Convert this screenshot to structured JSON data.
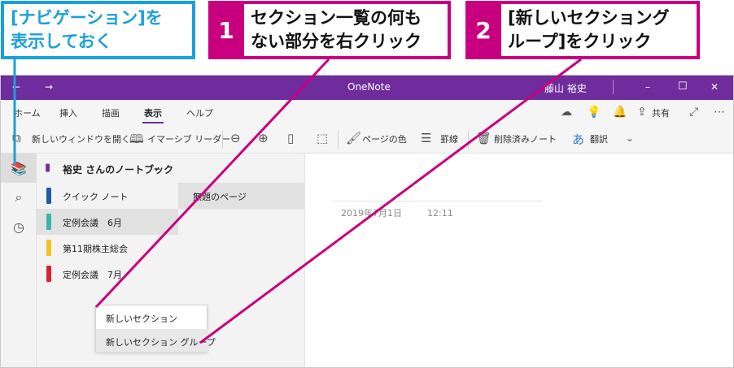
{
  "callouts": {
    "nav": {
      "line1": "[ナビゲーション]を",
      "line2": "表示しておく"
    },
    "step1": {
      "num": "1",
      "line1": "セクション一覧の何も",
      "line2": "ない部分を右クリック"
    },
    "step2": {
      "num": "2",
      "line1": "[新しいセクショング",
      "line2": "ループ]をクリック"
    }
  },
  "titlebar": {
    "title": "OneNote",
    "user": "藤山 裕史"
  },
  "ribbon": {
    "tabs": [
      "ホーム",
      "挿入",
      "描画",
      "表示",
      "ヘルプ"
    ],
    "active_tab": "表示",
    "share_label": "共有"
  },
  "toolbar": {
    "new_window": "新しいウィンドウを開く",
    "immersive_reader": "イマーシブ リーダー",
    "page_color": "ページの色",
    "rule_lines": "罫線",
    "deleted_notes": "削除済みノート",
    "translate": "翻訳"
  },
  "notebook": {
    "name": "裕史 さんのノートブック"
  },
  "sections": [
    {
      "label": "クイック ノート",
      "color": "#1f5aa6"
    },
    {
      "label": "定例会議　6月",
      "color": "#3bb3a6"
    },
    {
      "label": "第11期株主総会",
      "color": "#f0c419"
    },
    {
      "label": "定例会議　7月",
      "color": "#d9232d"
    }
  ],
  "page": {
    "title": "無題のページ",
    "date": "2019年7月1日",
    "time": "12:11"
  },
  "context_menu": {
    "items": [
      "新しいセクション",
      "新しいセクション グループ"
    ]
  },
  "colors": {
    "accent": "#6e2c9c",
    "callout_blue": "#1aa0dd",
    "callout_magenta": "#c8007f"
  }
}
